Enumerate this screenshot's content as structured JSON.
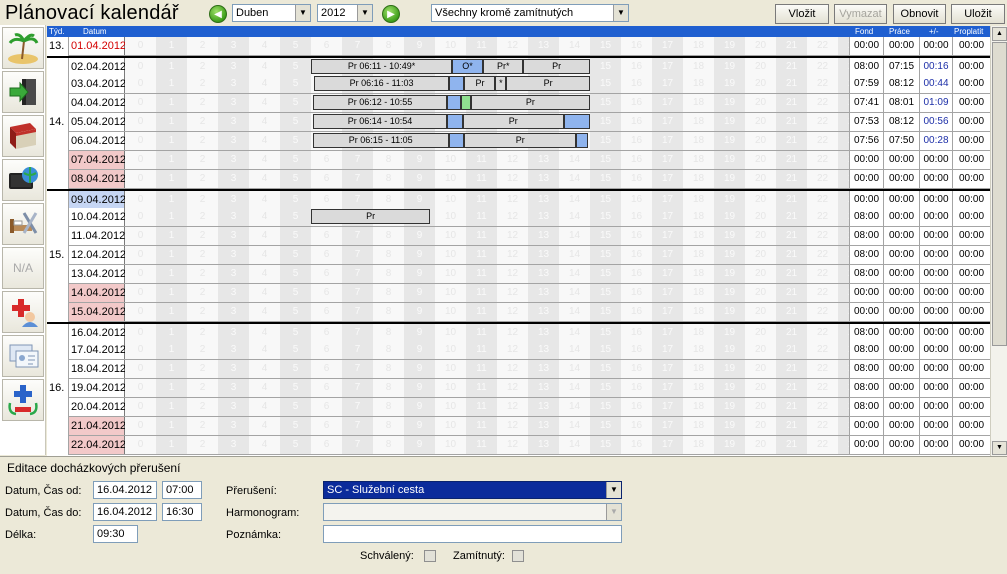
{
  "title": "Plánovací kalendář",
  "toolbar": {
    "month": "Duben",
    "year": "2012",
    "filter": "Všechny kromě zamítnutých",
    "insert": "Vložit",
    "delete": "Vymazat",
    "refresh": "Obnovit",
    "save": "Uložit"
  },
  "sidebar_icons": [
    "island-icon",
    "export-icon",
    "book-icon",
    "monitor-globe-icon",
    "bed-tools-icon",
    "na-icon",
    "medical-icon",
    "card-icon",
    "add-remove-icon"
  ],
  "sidebar_na": "N/A",
  "header": {
    "week": "Týd.",
    "date": "Datum",
    "fund": "Fond",
    "work": "Práce",
    "diff": "+/-",
    "paid": "Proplatit"
  },
  "hours": [
    "0",
    "1",
    "2",
    "3",
    "4",
    "5",
    "6",
    "7",
    "8",
    "9",
    "10",
    "11",
    "12",
    "13",
    "14",
    "15",
    "16",
    "17",
    "18",
    "19",
    "20",
    "21",
    "22",
    "23"
  ],
  "rows": [
    {
      "week": "13.",
      "date": "01.04.2012",
      "style": "red",
      "fund": "00:00",
      "work": "00:00",
      "diff": "00:00",
      "paid": "00:00",
      "wk": false
    },
    {
      "week": "",
      "date": "02.04.2012",
      "style": "",
      "fund": "08:00",
      "work": "07:15",
      "diff": "00:16",
      "paid": "00:00",
      "wk": true
    },
    {
      "week": "",
      "date": "03.04.2012",
      "style": "",
      "fund": "07:59",
      "work": "08:12",
      "diff": "00:44",
      "paid": "00:00",
      "wk": false
    },
    {
      "week": "",
      "date": "04.04.2012",
      "style": "",
      "fund": "07:41",
      "work": "08:01",
      "diff": "01:09",
      "paid": "00:00",
      "wk": false
    },
    {
      "week": "14.",
      "date": "05.04.2012",
      "style": "",
      "fund": "07:53",
      "work": "08:12",
      "diff": "00:56",
      "paid": "00:00",
      "wk": false
    },
    {
      "week": "",
      "date": "06.04.2012",
      "style": "",
      "fund": "07:56",
      "work": "07:50",
      "diff": "00:28",
      "paid": "00:00",
      "wk": false
    },
    {
      "week": "",
      "date": "07.04.2012",
      "style": "pink",
      "fund": "00:00",
      "work": "00:00",
      "diff": "00:00",
      "paid": "00:00",
      "wk": false
    },
    {
      "week": "",
      "date": "08.04.2012",
      "style": "pink",
      "fund": "00:00",
      "work": "00:00",
      "diff": "00:00",
      "paid": "00:00",
      "wk": false
    },
    {
      "week": "",
      "date": "09.04.2012",
      "style": "blue",
      "fund": "00:00",
      "work": "00:00",
      "diff": "00:00",
      "paid": "00:00",
      "wk": true
    },
    {
      "week": "",
      "date": "10.04.2012",
      "style": "",
      "fund": "08:00",
      "work": "00:00",
      "diff": "00:00",
      "paid": "00:00",
      "wk": false
    },
    {
      "week": "",
      "date": "11.04.2012",
      "style": "",
      "fund": "08:00",
      "work": "00:00",
      "diff": "00:00",
      "paid": "00:00",
      "wk": false
    },
    {
      "week": "15.",
      "date": "12.04.2012",
      "style": "",
      "fund": "08:00",
      "work": "00:00",
      "diff": "00:00",
      "paid": "00:00",
      "wk": false
    },
    {
      "week": "",
      "date": "13.04.2012",
      "style": "",
      "fund": "08:00",
      "work": "00:00",
      "diff": "00:00",
      "paid": "00:00",
      "wk": false
    },
    {
      "week": "",
      "date": "14.04.2012",
      "style": "pink",
      "fund": "00:00",
      "work": "00:00",
      "diff": "00:00",
      "paid": "00:00",
      "wk": false
    },
    {
      "week": "",
      "date": "15.04.2012",
      "style": "pink",
      "fund": "00:00",
      "work": "00:00",
      "diff": "00:00",
      "paid": "00:00",
      "wk": false
    },
    {
      "week": "",
      "date": "16.04.2012",
      "style": "",
      "fund": "08:00",
      "work": "00:00",
      "diff": "00:00",
      "paid": "00:00",
      "wk": true
    },
    {
      "week": "",
      "date": "17.04.2012",
      "style": "",
      "fund": "08:00",
      "work": "00:00",
      "diff": "00:00",
      "paid": "00:00",
      "wk": false
    },
    {
      "week": "",
      "date": "18.04.2012",
      "style": "",
      "fund": "08:00",
      "work": "00:00",
      "diff": "00:00",
      "paid": "00:00",
      "wk": false
    },
    {
      "week": "16.",
      "date": "19.04.2012",
      "style": "",
      "fund": "08:00",
      "work": "00:00",
      "diff": "00:00",
      "paid": "00:00",
      "wk": false
    },
    {
      "week": "",
      "date": "20.04.2012",
      "style": "",
      "fund": "08:00",
      "work": "00:00",
      "diff": "00:00",
      "paid": "00:00",
      "wk": false
    },
    {
      "week": "",
      "date": "21.04.2012",
      "style": "pink",
      "fund": "00:00",
      "work": "00:00",
      "diff": "00:00",
      "paid": "00:00",
      "wk": false
    },
    {
      "week": "",
      "date": "22.04.2012",
      "style": "pink",
      "fund": "00:00",
      "work": "00:00",
      "diff": "00:00",
      "paid": "00:00",
      "wk": false
    }
  ],
  "bars": [
    {
      "row": 1,
      "label": "Pr 06:11 - 10:49*",
      "from": 6.0,
      "to": 10.55,
      "kind": "gray"
    },
    {
      "row": 1,
      "label": "O*",
      "from": 10.55,
      "to": 11.55,
      "kind": "blue"
    },
    {
      "row": 1,
      "label": "Pr*",
      "from": 11.55,
      "to": 12.85,
      "kind": "gray"
    },
    {
      "row": 1,
      "label": "Pr",
      "from": 12.85,
      "to": 15.0,
      "kind": "gray"
    },
    {
      "row": 2,
      "label": "Pr 06:16 - 11:03",
      "from": 6.1,
      "to": 10.45,
      "kind": "gray"
    },
    {
      "row": 2,
      "label": "",
      "from": 10.45,
      "to": 10.95,
      "kind": "blue"
    },
    {
      "row": 2,
      "label": "Pr",
      "from": 10.95,
      "to": 11.95,
      "kind": "gray"
    },
    {
      "row": 2,
      "label": "*",
      "from": 11.95,
      "to": 12.3,
      "kind": "gray"
    },
    {
      "row": 2,
      "label": "Pr",
      "from": 12.3,
      "to": 15.0,
      "kind": "gray"
    },
    {
      "row": 3,
      "label": "Pr 06:12 - 10:55",
      "from": 6.05,
      "to": 10.4,
      "kind": "gray"
    },
    {
      "row": 3,
      "label": "",
      "from": 10.4,
      "to": 10.85,
      "kind": "blue"
    },
    {
      "row": 3,
      "label": "",
      "from": 10.85,
      "to": 11.15,
      "kind": "green"
    },
    {
      "row": 3,
      "label": "Pr",
      "from": 11.15,
      "to": 15.0,
      "kind": "gray"
    },
    {
      "row": 4,
      "label": "Pr 06:14 - 10:54",
      "from": 6.05,
      "to": 10.4,
      "kind": "gray"
    },
    {
      "row": 4,
      "label": "",
      "from": 10.4,
      "to": 10.9,
      "kind": "blue"
    },
    {
      "row": 4,
      "label": "Pr",
      "from": 10.9,
      "to": 14.15,
      "kind": "gray"
    },
    {
      "row": 4,
      "label": "",
      "from": 14.15,
      "to": 15.0,
      "kind": "blue"
    },
    {
      "row": 5,
      "label": "Pr 06:15 - 11:05",
      "from": 6.05,
      "to": 10.45,
      "kind": "gray"
    },
    {
      "row": 5,
      "label": "",
      "from": 10.45,
      "to": 10.95,
      "kind": "blue"
    },
    {
      "row": 5,
      "label": "Pr",
      "from": 10.95,
      "to": 14.55,
      "kind": "gray"
    },
    {
      "row": 5,
      "label": "",
      "from": 14.55,
      "to": 14.95,
      "kind": "blue"
    },
    {
      "row": 9,
      "label": "Pr",
      "from": 6.0,
      "to": 9.85,
      "kind": "gray"
    }
  ],
  "editor": {
    "title": "Editace docházkových přerušení",
    "from_label": "Datum, Čas od:",
    "from_date": "16.04.2012",
    "from_time": "07:00",
    "to_label": "Datum, Čas do:",
    "to_date": "16.04.2012",
    "to_time": "16:30",
    "length_label": "Délka:",
    "length": "09:30",
    "break_label": "Přerušení:",
    "break_value": "SC - Služební cesta",
    "schedule_label": "Harmonogram:",
    "schedule_value": "",
    "note_label": "Poznámka:",
    "note_value": "",
    "approved_label": "Schválený:",
    "rejected_label": "Zamítnutý:"
  }
}
